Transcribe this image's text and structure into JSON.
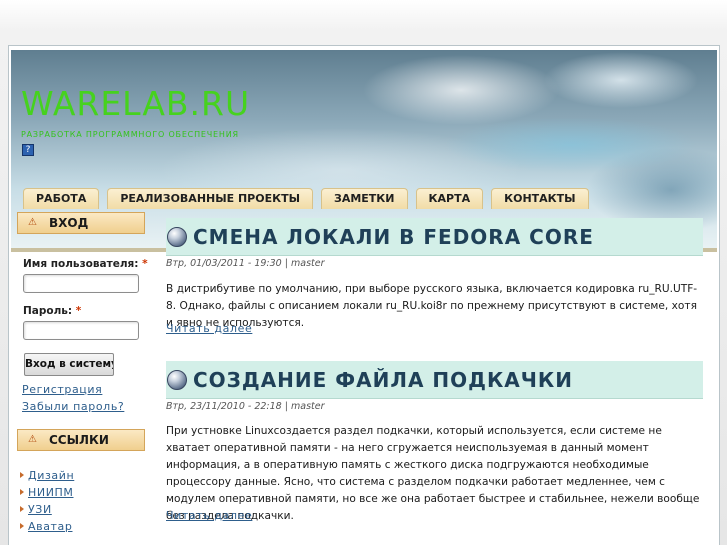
{
  "site": {
    "name": "WARELAB.RU",
    "slogan": "РАЗРАБОТКА ПРОГРАММНОГО ОБЕСПЕЧЕНИЯ",
    "help_icon": "?"
  },
  "nav": {
    "tabs": [
      "РАБОТА",
      "РЕАЛИЗОВАННЫЕ ПРОЕКТЫ",
      "ЗАМЕТКИ",
      "КАРТА",
      "КОНТАКТЫ"
    ]
  },
  "sidebar": {
    "login": {
      "title": "ВХОД",
      "username_label": "Имя пользователя:",
      "password_label": "Пароль:",
      "required_mark": "*",
      "submit_label": "Вход в систему",
      "register_link": "Регистрация",
      "forgot_link": "Забыли пароль?"
    },
    "links": {
      "title": "ССЫЛКИ",
      "items": [
        "Дизайн",
        "НИИПМ",
        "УЗИ",
        "Аватар"
      ]
    }
  },
  "posts": [
    {
      "title": "СМЕНА ЛОКАЛИ В FEDORA CORE",
      "date": "Втр, 01/03/2011 - 19:30",
      "separator": "|",
      "author": "master",
      "body": "В дистрибутиве по умолчанию, при выборе русского языка, включается кодировка ru_RU.UTF-8. Однако, файлы с описанием локали ru_RU.koi8r по прежнему присутствуют в системе, хотя и явно не используются.",
      "read_more": "Читать далее"
    },
    {
      "title": "СОЗДАНИЕ ФАЙЛА ПОДКАЧКИ",
      "date": "Втр, 23/11/2010 - 22:18",
      "separator": "|",
      "author": "master",
      "body": "При устновке  Linuxсоздается раздел подкачки, который используется, если системе не хватает оперативной памяти - на него сгружается неиспользуемая в данный момент   информация, а в оперативную память с жесткого диска подгружаются необходимые процессору данные. Ясно, что система с разделом подкачки работает медленнее, чем с модулем оперативной памяти, но все же она работает быстрее и стабильнее, нежели вообще без раздела подкачки.",
      "read_more": "Читать далее"
    }
  ],
  "colors": {
    "title_green": "#46d21e",
    "tab_bg": "#f1dca6",
    "post_title_bg": "#d3efe8",
    "link": "#2e5e8c"
  }
}
